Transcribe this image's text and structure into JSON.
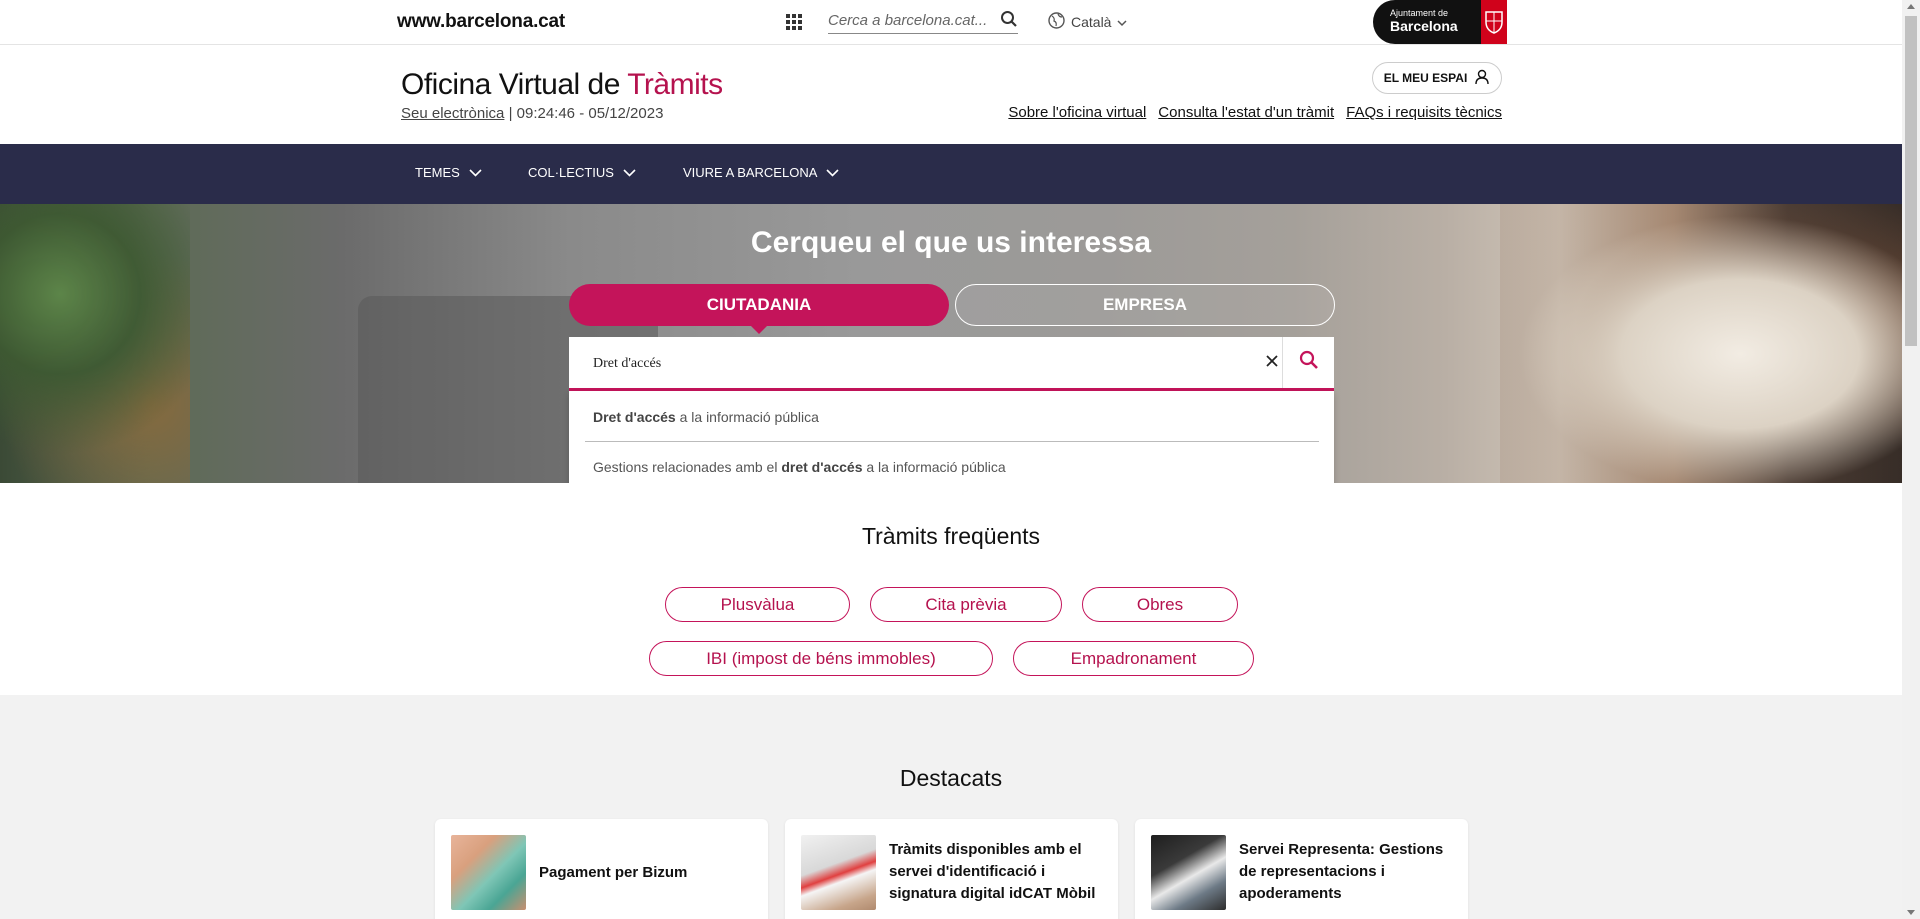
{
  "topbar": {
    "site_url": "www.barcelona.cat",
    "search_placeholder": "Cerca a barcelona.cat...",
    "language": "Català",
    "logo_line1": "Ajuntament de",
    "logo_line2": "Barcelona"
  },
  "header": {
    "title_main": "Oficina Virtual de ",
    "title_accent": "Tràmits",
    "seu_link": "Seu electrònica",
    "timestamp": " | 09:24:46 - 05/12/2023",
    "my_space": "EL MEU ESPAI",
    "links": [
      "Sobre l'oficina virtual",
      "Consulta l'estat d'un tràmit",
      "FAQs i requisits tècnics"
    ]
  },
  "nav": {
    "items": [
      "TEMES",
      "COL·LECTIUS",
      "VIURE A BARCELONA"
    ]
  },
  "hero": {
    "title": "Cerqueu el que us interessa",
    "tab_citizen": "CIUTADANIA",
    "tab_company": "EMPRESA",
    "search_value": "Dret d'accés"
  },
  "suggestions": [
    {
      "bold": "Dret d'accés",
      "after": " a la informació pública"
    },
    {
      "before": "Gestions relacionades amb el ",
      "bold": "dret d'accés",
      "after": " a la informació pública"
    }
  ],
  "frequent": {
    "title": "Tràmits freqüents",
    "items": [
      "Plusvàlua",
      "Cita prèvia",
      "Obres",
      "IBI (impost de béns immobles)",
      "Empadronament"
    ]
  },
  "highlights": {
    "title": "Destacats",
    "cards": [
      {
        "text": "Pagament per Bizum"
      },
      {
        "text": "Tràmits disponibles amb el servei d'identificació i signatura digital idCAT Mòbil"
      },
      {
        "text": "Servei Representa: Gestions de representacions i apoderaments"
      }
    ]
  },
  "colors": {
    "accent": "#c4145a",
    "nav_bg": "#2a2c4a",
    "logo_red": "#d0021b"
  }
}
